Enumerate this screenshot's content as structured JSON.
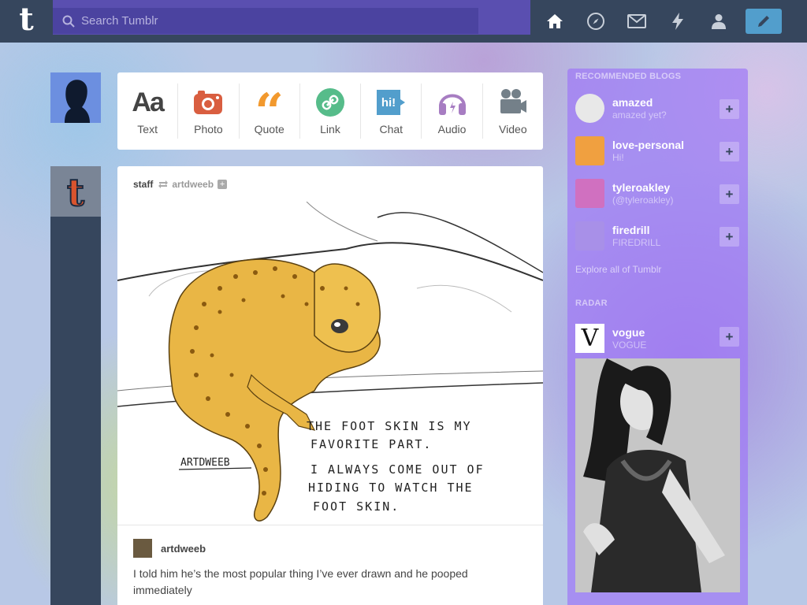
{
  "topbar": {
    "logo": "t",
    "search_placeholder": "Search Tumblr",
    "nav_icons": [
      "home-icon",
      "explore-icon",
      "inbox-icon",
      "activity-icon",
      "account-icon"
    ],
    "compose_icon": "pencil-icon"
  },
  "post_types": [
    {
      "label": "Text",
      "icon": "text-icon",
      "color": "#444444"
    },
    {
      "label": "Photo",
      "icon": "camera-icon",
      "color": "#d95e40"
    },
    {
      "label": "Quote",
      "icon": "quote-icon",
      "color": "#f2992e"
    },
    {
      "label": "Link",
      "icon": "link-icon",
      "color": "#56bc8a"
    },
    {
      "label": "Chat",
      "icon": "chat-icon",
      "color": "#529ecc"
    },
    {
      "label": "Audio",
      "icon": "headphones-icon",
      "color": "#a77dc2"
    },
    {
      "label": "Video",
      "icon": "video-camera-icon",
      "color": "#748089"
    }
  ],
  "post": {
    "author": "staff",
    "reblogged_from": "artdweeb",
    "artwork_signature": "ARTDWEEB",
    "artwork_text": [
      "THE FOOT SKIN IS MY",
      "FAVORITE PART.",
      "I ALWAYS COME OUT OF",
      "HIDING TO WATCH THE",
      "FOOT SKIN."
    ],
    "reblog_user": "artdweeb",
    "caption": "I told him he’s the most popular thing I’ve ever drawn and he pooped immediately"
  },
  "sidebar": {
    "recommended_heading": "RECOMMENDED BLOGS",
    "recommended": [
      {
        "name": "amazed",
        "sub": "amazed yet?",
        "color": "#e8e8e8"
      },
      {
        "name": "love-personal",
        "sub": "Hi!",
        "color": "#f0a040"
      },
      {
        "name": "tyleroakley",
        "sub": "(@tyleroakley)",
        "color": "#d070c0"
      },
      {
        "name": "firedrill",
        "sub": "FIREDRILL",
        "color": "#a890e8"
      }
    ],
    "explore_link": "Explore all of Tumblr",
    "radar_heading": "RADAR",
    "radar_blog": {
      "name": "vogue",
      "sub": "VOGUE",
      "logo": "V"
    }
  }
}
